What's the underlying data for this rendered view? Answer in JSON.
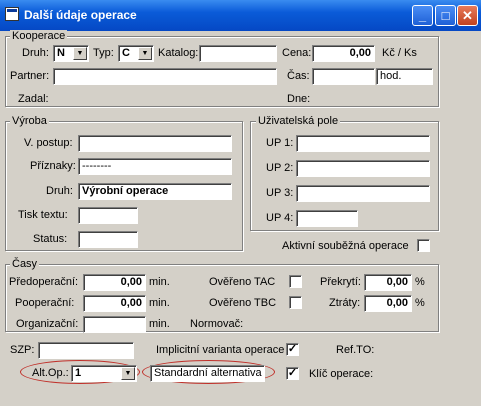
{
  "window": {
    "title": "Další údaje operace",
    "btn_min": "_",
    "btn_max": "□",
    "btn_close": "✕"
  },
  "kooperace": {
    "legend": "Kooperace",
    "druh_label": "Druh:",
    "druh_value": "N",
    "typ_label": "Typ:",
    "typ_value": "C",
    "katalog_label": "Katalog:",
    "katalog_value": "",
    "cena_label": "Cena:",
    "cena_value": "0,00",
    "cena_unit": "Kč / Ks",
    "partner_label": "Partner:",
    "partner_value": "",
    "cas_label": "Čas:",
    "cas_value": "",
    "cas_unit_value": "hod.",
    "zadal_label": "Zadal:",
    "dne_label": "Dne:"
  },
  "vyroba": {
    "legend": "Výroba",
    "postup_label": "V. postup:",
    "postup_value": "",
    "priznaky_label": "Příznaky:",
    "priznaky_value": "--------",
    "druh_label": "Druh:",
    "druh_value": "Výrobní operace",
    "tisk_label": "Tisk textu:",
    "tisk_value": "",
    "status_label": "Status:",
    "status_value": ""
  },
  "uziv": {
    "legend": "Uživatelská pole",
    "up1_label": "UP 1:",
    "up2_label": "UP 2:",
    "up3_label": "UP 3:",
    "up4_label": "UP 4:",
    "up1_value": "",
    "up2_value": "",
    "up3_value": "",
    "up4_value": ""
  },
  "aktivni_label": "Aktivní souběžná operace",
  "casy": {
    "legend": "Časy",
    "pred_label": "Předoperační:",
    "pred_value": "0,00",
    "pred_unit": "min.",
    "poop_label": "Pooperační:",
    "poop_value": "0,00",
    "poop_unit": "min.",
    "org_label": "Organizační:",
    "org_value": "",
    "org_unit": "min.",
    "tac_label": "Ověřeno TAC",
    "tbc_label": "Ověřeno TBC",
    "prekryti_label": "Překrytí:",
    "prekryti_value": "0,00",
    "prekryti_unit": "%",
    "ztraty_label": "Ztráty:",
    "ztraty_value": "0,00",
    "ztraty_unit": "%",
    "normovac_label": "Normovač:"
  },
  "bottom": {
    "szp_label": "SZP:",
    "szp_value": "",
    "implicitni_label": "Implicitní varianta operace",
    "implicitni_checked": "✓",
    "ref_label": "Ref.TO:",
    "altop_label": "Alt.Op.:",
    "altop_value": "1",
    "standard_value": "Standardní alternativa",
    "standard_checked": "✓",
    "klic_label": "Klíč operace:"
  },
  "colors": {
    "title_bar": "#0a5bd8",
    "highlight_oval": "#c0302a",
    "dialog_bg": "#d4d0c8"
  }
}
